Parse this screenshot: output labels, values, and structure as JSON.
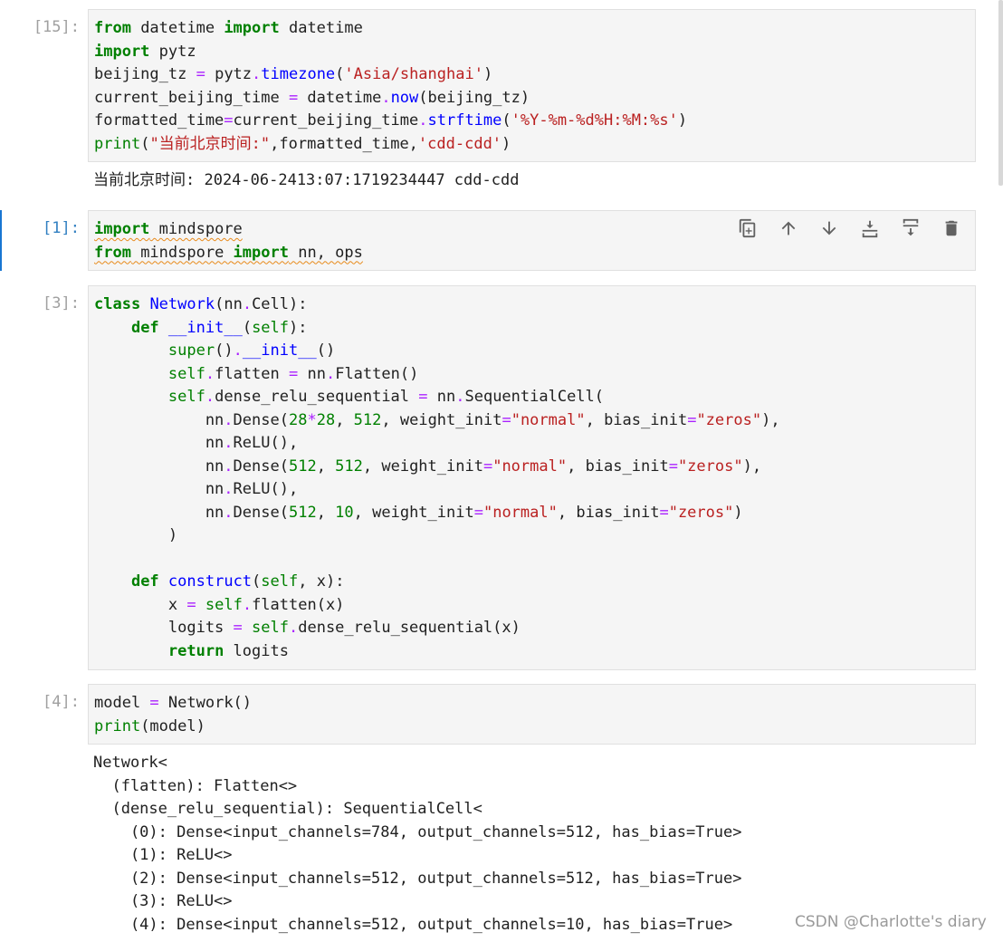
{
  "cells": [
    {
      "prompt": "[15]:",
      "lines": [
        "from datetime import datetime",
        "import pytz",
        "beijing_tz = pytz.timezone('Asia/shanghai')",
        "current_beijing_time = datetime.now(beijing_tz)",
        "formatted_time=current_beijing_time.strftime('%Y-%m-%d%H:%M:%s')",
        "print(\"当前北京时间:\",formatted_time,'cdd-cdd')"
      ],
      "output": "当前北京时间: 2024-06-2413:07:1719234447 cdd-cdd"
    },
    {
      "prompt": "[1]:",
      "lines": [
        "import mindspore",
        "from mindspore import nn, ops"
      ]
    },
    {
      "prompt": "[3]:",
      "lines": [
        "class Network(nn.Cell):",
        "    def __init__(self):",
        "        super().__init__()",
        "        self.flatten = nn.Flatten()",
        "        self.dense_relu_sequential = nn.SequentialCell(",
        "            nn.Dense(28*28, 512, weight_init=\"normal\", bias_init=\"zeros\"),",
        "            nn.ReLU(),",
        "            nn.Dense(512, 512, weight_init=\"normal\", bias_init=\"zeros\"),",
        "            nn.ReLU(),",
        "            nn.Dense(512, 10, weight_init=\"normal\", bias_init=\"zeros\")",
        "        )",
        "",
        "    def construct(self, x):",
        "        x = self.flatten(x)",
        "        logits = self.dense_relu_sequential(x)",
        "        return logits"
      ]
    },
    {
      "prompt": "[4]:",
      "lines": [
        "model = Network()",
        "print(model)"
      ],
      "output_lines": [
        "Network<",
        "  (flatten): Flatten<>",
        "  (dense_relu_sequential): SequentialCell<",
        "    (0): Dense<input_channels=784, output_channels=512, has_bias=True>",
        "    (1): ReLU<>",
        "    (2): Dense<input_channels=512, output_channels=512, has_bias=True>",
        "    (3): ReLU<>",
        "    (4): Dense<input_channels=512, output_channels=10, has_bias=True>"
      ]
    }
  ],
  "toolbar": [
    "duplicate-icon",
    "move-up-icon",
    "move-down-icon",
    "insert-above-icon",
    "insert-below-icon",
    "delete-icon"
  ],
  "watermark": "CSDN @Charlotte's diary",
  "colors": {
    "keyword": "#008000",
    "string": "#ba2121",
    "function": "#0000ff",
    "operator": "#aa22ff",
    "prompt": "#a0a0a0",
    "active": "#1976d2"
  }
}
